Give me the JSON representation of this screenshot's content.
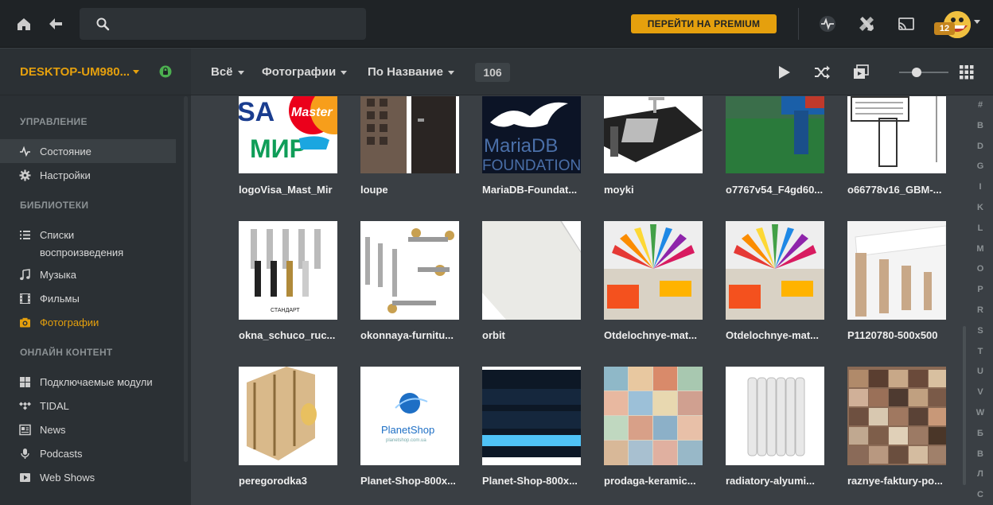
{
  "topbar": {
    "search_placeholder": "",
    "premium_label": "ПЕРЕЙТИ НА PREMIUM",
    "notification_count": "12"
  },
  "sidebar": {
    "server_name": "DESKTOP-UM980...",
    "sections": {
      "manage": "УПРАВЛЕНИЕ",
      "libraries": "БИБЛИОТЕКИ",
      "online": "ОНЛАЙН КОНТЕНТ"
    },
    "manage_items": [
      {
        "label": "Состояние",
        "icon": "activity-icon"
      },
      {
        "label": "Настройки",
        "icon": "gear-icon"
      }
    ],
    "library_items": [
      {
        "label": "Списки",
        "label2": "воспроизведения",
        "icon": "list-icon"
      },
      {
        "label": "Музыка",
        "icon": "music-icon"
      },
      {
        "label": "Фильмы",
        "icon": "film-icon"
      },
      {
        "label": "Фотографии",
        "icon": "camera-icon"
      }
    ],
    "online_items": [
      {
        "label": "Подключаемые модули",
        "icon": "grid-icon"
      },
      {
        "label": "TIDAL",
        "icon": "tidal-icon"
      },
      {
        "label": "News",
        "icon": "news-icon"
      },
      {
        "label": "Podcasts",
        "icon": "microphone-icon"
      },
      {
        "label": "Web Shows",
        "icon": "play-icon"
      }
    ]
  },
  "filterbar": {
    "filter_all": "Всё",
    "filter_type": "Фотографии",
    "sort": "По Название",
    "count": "106"
  },
  "photos": [
    {
      "caption": "logoVisa_Mast_Mir"
    },
    {
      "caption": "loupe"
    },
    {
      "caption": "MariaDB-Foundat..."
    },
    {
      "caption": "moyki"
    },
    {
      "caption": "o7767v54_F4gd60..."
    },
    {
      "caption": "o66778v16_GBM-..."
    },
    {
      "caption": "okna_schuco_ruc..."
    },
    {
      "caption": "okonnaya-furnitu..."
    },
    {
      "caption": "orbit"
    },
    {
      "caption": "Otdelochnye-mat..."
    },
    {
      "caption": "Otdelochnye-mat..."
    },
    {
      "caption": "P1120780-500x500"
    },
    {
      "caption": "peregorodka3"
    },
    {
      "caption": "Planet-Shop-800x..."
    },
    {
      "caption": "Planet-Shop-800x..."
    },
    {
      "caption": "prodaga-keramic..."
    },
    {
      "caption": "radiatory-alyumi..."
    },
    {
      "caption": "raznye-faktury-po..."
    }
  ],
  "thumb_text": {
    "mir": "МИР",
    "master": "Master",
    "visa": "SA",
    "mariadb1": "MariaDB",
    "mariadb2": "FOUNDATION",
    "standart": "СТАНДАРТ",
    "planet": "PlanetShop",
    "planet_sub": "planetshop.com.ua"
  },
  "alphabet": [
    "#",
    "B",
    "D",
    "G",
    "I",
    "K",
    "L",
    "M",
    "O",
    "P",
    "R",
    "S",
    "T",
    "U",
    "V",
    "W",
    "Б",
    "В",
    "Л",
    "С"
  ],
  "colors": {
    "accent": "#e5a00d",
    "background": "#3a3f44",
    "sidebar": "#2b3034",
    "topbar": "#1f2326"
  }
}
